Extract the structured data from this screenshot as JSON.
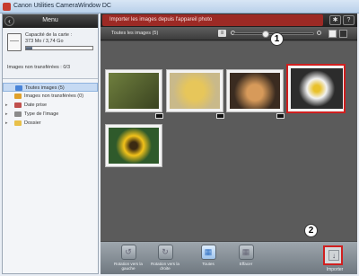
{
  "window": {
    "title": "Canon Utilities CameraWindow DC"
  },
  "left_panel": {
    "menu_label": "Menu",
    "card": {
      "capacity_label": "Capacité de la carte :",
      "capacity_value": "373 Mo / 3,74 Go",
      "used_fraction": 0.1,
      "untransferred": "Images non transférées : 0/3"
    },
    "tree": [
      {
        "label": "Toutes images (5)",
        "selected": true,
        "icon": "all-images-icon",
        "color": "#4a84d8"
      },
      {
        "label": "Images non transférées (0)",
        "selected": false,
        "icon": "untransferred-icon",
        "color": "#e0a12a"
      },
      {
        "label": "Date prise",
        "selected": false,
        "icon": "calendar-icon",
        "color": "#c0504d"
      },
      {
        "label": "Type de l'image",
        "selected": false,
        "icon": "image-type-icon",
        "color": "#8a8a8a"
      },
      {
        "label": "Dossier",
        "selected": false,
        "icon": "folder-icon",
        "color": "#e8c04a"
      }
    ]
  },
  "main": {
    "header_title": "Importer les images depuis l'appareil photo",
    "settings_icon": "gear-icon",
    "help_label": "?",
    "tab_label": "Toutes les images (5)",
    "zoom_level": 0.4,
    "thumbnails": [
      {
        "subject": "cat on grass",
        "colors": [
          "#6f7f3e",
          "#3a4320"
        ],
        "selected": false
      },
      {
        "subject": "chick",
        "colors": [
          "#c9b98a",
          "#e7c65a"
        ],
        "selected": false
      },
      {
        "subject": "kitten",
        "colors": [
          "#3a2b20",
          "#d79a5a"
        ],
        "selected": false
      },
      {
        "subject": "daisy",
        "colors": [
          "#2c2c2c",
          "#f2f2f2"
        ],
        "selected": true
      },
      {
        "subject": "sunflower",
        "colors": [
          "#2f5a2b",
          "#f2c21a"
        ],
        "selected": false
      }
    ],
    "actions": [
      {
        "label": "Rotation vers la gauche",
        "icon": "rotate-left-icon"
      },
      {
        "label": "Rotation vers la droite",
        "icon": "rotate-right-icon"
      },
      {
        "label": "Toutes",
        "icon": "select-all-icon"
      },
      {
        "label": "Effacer",
        "icon": "erase-icon"
      }
    ],
    "import_label": "Importer",
    "callouts": [
      "1",
      "2"
    ],
    "accent_color": "#d01f1f"
  }
}
